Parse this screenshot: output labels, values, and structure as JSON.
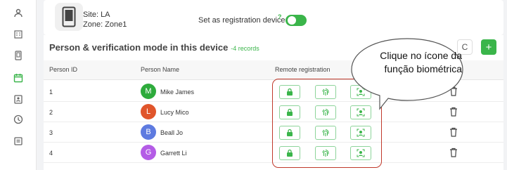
{
  "sidebar": {
    "icons": [
      "user-icon",
      "building-icon",
      "device-icon",
      "calendar-icon",
      "badge-icon",
      "clock-icon",
      "list-icon"
    ],
    "active": "calendar-icon"
  },
  "device": {
    "site": "Site: LA",
    "zone": "Zone: Zone1",
    "registration_label": "Set as registration device",
    "help_mark": "?",
    "registration_enabled": true
  },
  "section": {
    "title": "Person & verification mode in this device",
    "count": "-4 records",
    "refresh_icon": "C",
    "add_icon": "+"
  },
  "table": {
    "headers": {
      "id": "Person ID",
      "name": "Person Name",
      "remote": "Remote registration"
    },
    "rows": [
      {
        "id": "1",
        "initial": "M",
        "name": "Mike James",
        "avatar_color": "#2eab3c"
      },
      {
        "id": "2",
        "initial": "L",
        "name": "Lucy Mico",
        "avatar_color": "#e0552b"
      },
      {
        "id": "3",
        "initial": "B",
        "name": "Beall Jo",
        "avatar_color": "#5e7be0"
      },
      {
        "id": "4",
        "initial": "G",
        "name": "Garrett Li",
        "avatar_color": "#b45ce6"
      }
    ]
  },
  "callout": {
    "line1": "Clique no ícone da",
    "line2": "função biométrica"
  },
  "colors": {
    "accent": "#3ab54a",
    "highlight": "#c0392b"
  }
}
